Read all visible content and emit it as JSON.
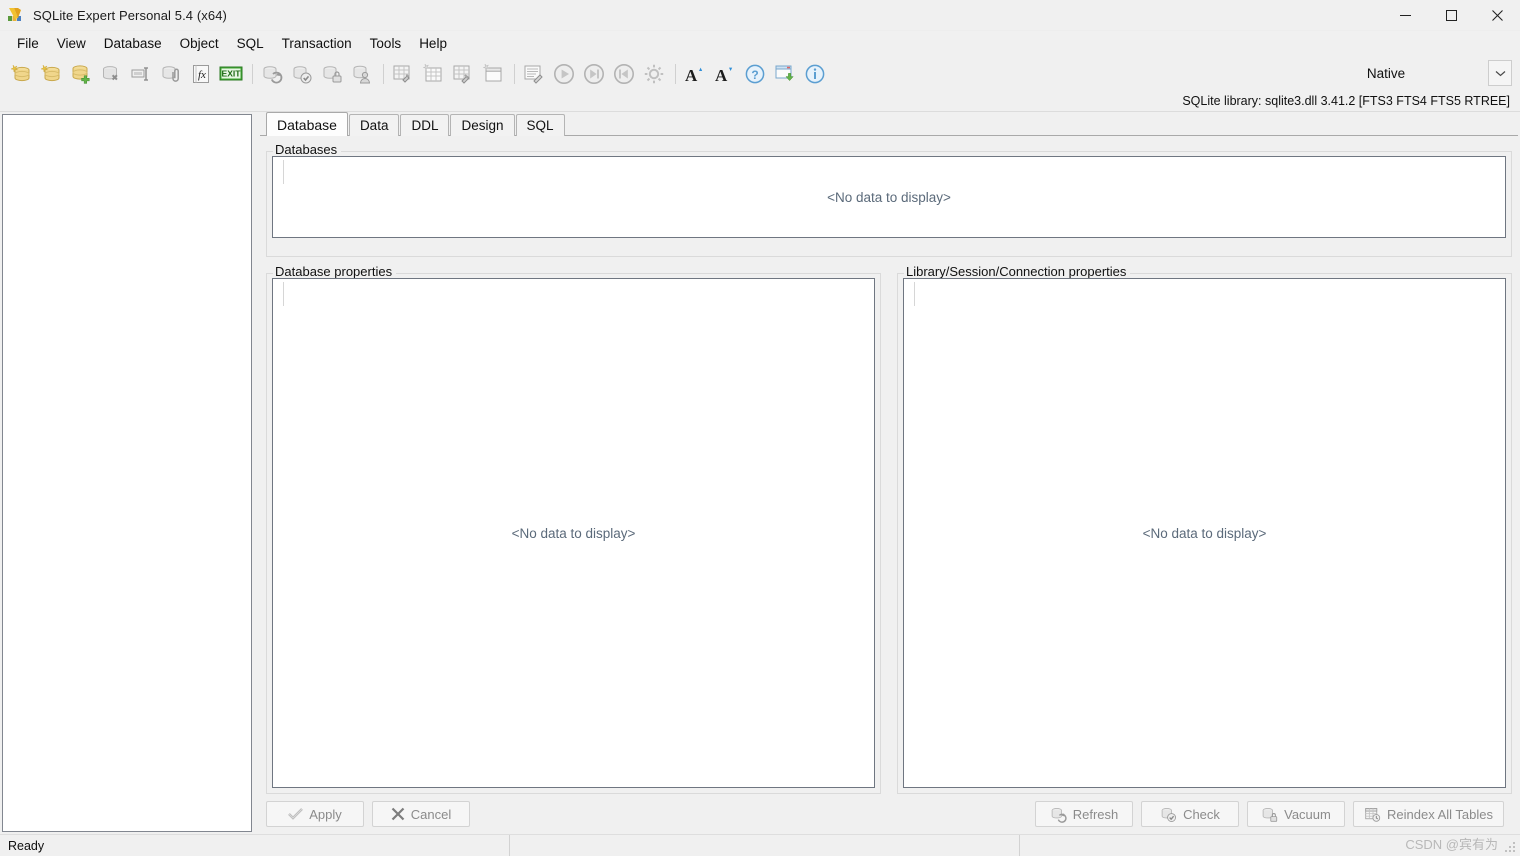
{
  "window": {
    "title": "SQLite Expert Personal 5.4 (x64)",
    "app_icon": "sqlite-expert-logo-icon",
    "controls": [
      {
        "name": "minimize-button",
        "glyph": "—"
      },
      {
        "name": "maximize-button",
        "glyph": "□"
      },
      {
        "name": "close-button",
        "glyph": "✕"
      }
    ]
  },
  "menubar": {
    "items": [
      {
        "label": "File"
      },
      {
        "label": "View"
      },
      {
        "label": "Database"
      },
      {
        "label": "Object"
      },
      {
        "label": "SQL"
      },
      {
        "label": "Transaction"
      },
      {
        "label": "Tools"
      },
      {
        "label": "Help"
      }
    ]
  },
  "toolbar": {
    "buttons": [
      {
        "name": "new-database-button",
        "icon": "database-new-icon",
        "enabled": true
      },
      {
        "name": "open-database-button",
        "icon": "database-open-icon",
        "enabled": true
      },
      {
        "name": "add-database-button",
        "icon": "database-add-icon",
        "enabled": true
      },
      {
        "name": "remove-database-button",
        "icon": "database-delete-icon",
        "enabled": false
      },
      {
        "name": "rename-database-button",
        "icon": "rename-icon",
        "enabled": false
      },
      {
        "name": "attach-database-button",
        "icon": "database-attach-icon",
        "enabled": false
      },
      {
        "name": "function-button",
        "icon": "fx-function-icon",
        "enabled": true
      },
      {
        "name": "export-exit-button",
        "icon": "exit-export-icon",
        "enabled": true
      },
      {
        "name": "refresh-database-button",
        "icon": "database-refresh-icon",
        "enabled": false
      },
      {
        "name": "check-database-button",
        "icon": "database-check-icon",
        "enabled": false
      },
      {
        "name": "vacuum-database-button",
        "icon": "database-vacuum-icon",
        "enabled": false
      },
      {
        "name": "database-user-button",
        "icon": "database-user-icon",
        "enabled": false
      },
      {
        "name": "edit-table-button",
        "icon": "table-edit-icon",
        "enabled": false
      },
      {
        "name": "new-table-button",
        "icon": "table-new-icon",
        "enabled": false
      },
      {
        "name": "design-table-button",
        "icon": "table-design-icon",
        "enabled": false
      },
      {
        "name": "new-view-button",
        "icon": "view-new-icon",
        "enabled": false
      },
      {
        "name": "edit-sql-button",
        "icon": "sql-edit-icon",
        "enabled": false
      },
      {
        "name": "execute-button",
        "icon": "play-icon",
        "enabled": false
      },
      {
        "name": "execute-next-button",
        "icon": "play-next-icon",
        "enabled": false
      },
      {
        "name": "execute-previous-button",
        "icon": "play-previous-icon",
        "enabled": false
      },
      {
        "name": "options-button",
        "icon": "gear-icon",
        "enabled": false
      },
      {
        "name": "increase-font-button",
        "icon": "font-increase-icon",
        "enabled": true
      },
      {
        "name": "decrease-font-button",
        "icon": "font-decrease-icon",
        "enabled": true
      },
      {
        "name": "help-button",
        "icon": "question-help-icon",
        "enabled": true
      },
      {
        "name": "download-window-button",
        "icon": "window-download-icon",
        "enabled": true
      },
      {
        "name": "about-button",
        "icon": "info-icon",
        "enabled": true
      }
    ],
    "mode_selector": {
      "value": "Native",
      "arrow_icon": "chevron-down-icon"
    }
  },
  "library_info": "SQLite library: sqlite3.dll 3.41.2 [FTS3 FTS4 FTS5 RTREE]",
  "tabs": [
    {
      "label": "Database",
      "active": true
    },
    {
      "label": "Data",
      "active": false
    },
    {
      "label": "DDL",
      "active": false
    },
    {
      "label": "Design",
      "active": false
    },
    {
      "label": "SQL",
      "active": false
    }
  ],
  "panels": {
    "databases": {
      "title": "Databases",
      "empty_text": "<No data to display>"
    },
    "database_properties": {
      "title": "Database properties",
      "empty_text": "<No data to display>"
    },
    "library_properties": {
      "title": "Library/Session/Connection properties",
      "empty_text": "<No data to display>"
    }
  },
  "action_buttons": {
    "left": [
      {
        "label": "Apply",
        "icon": "check-apply-icon",
        "name": "apply-button"
      },
      {
        "label": "Cancel",
        "icon": "x-cancel-icon",
        "name": "cancel-button"
      }
    ],
    "right": [
      {
        "label": "Refresh",
        "icon": "database-refresh-icon",
        "name": "refresh-button"
      },
      {
        "label": "Check",
        "icon": "database-check-icon",
        "name": "check-button"
      },
      {
        "label": "Vacuum",
        "icon": "database-vacuum-icon",
        "name": "vacuum-button"
      },
      {
        "label": "Reindex All Tables",
        "icon": "table-reindex-icon",
        "name": "reindex-all-tables-button"
      }
    ]
  },
  "statusbar": {
    "message": "Ready",
    "cell2": "",
    "cell3": "",
    "watermark": "CSDN @宾有为"
  },
  "colors": {
    "window_bg": "#f0f0f0",
    "panel_bg": "#ffffff",
    "border": "#828790",
    "nodata_text": "#5b6a7a",
    "disabled_text": "#8b8b8b",
    "close_hover": "#e81123"
  }
}
